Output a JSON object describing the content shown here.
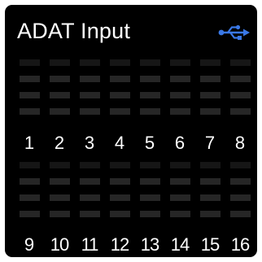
{
  "title": "ADAT Input",
  "icon": "usb-icon",
  "colors": {
    "background": "#000000",
    "segment_top": "#161616",
    "segment": "#262626",
    "text": "#ffffff",
    "accent": "#3a78e6"
  },
  "rows": [
    {
      "channels": [
        "1",
        "2",
        "3",
        "4",
        "5",
        "6",
        "7",
        "8"
      ]
    },
    {
      "channels": [
        "9",
        "10",
        "11",
        "12",
        "13",
        "14",
        "15",
        "16"
      ]
    }
  ]
}
